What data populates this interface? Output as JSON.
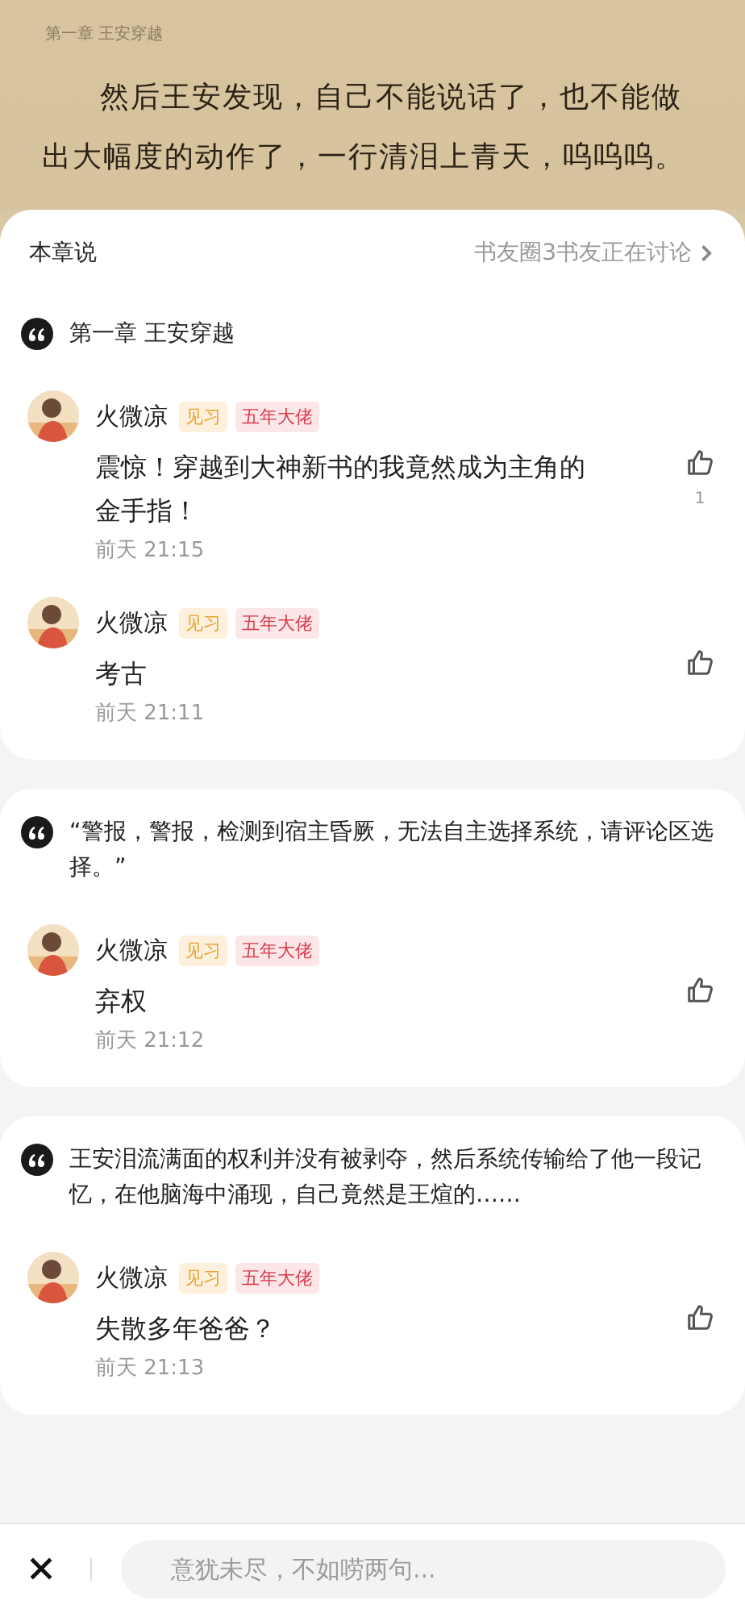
{
  "reader": {
    "chapter_title": "第一章 王安穿越",
    "paragraph": "然后王安发现，自己不能说话了，也不能做出大幅度的动作了，一行清泪上青天，呜呜呜。"
  },
  "panel": {
    "title": "本章说",
    "discussion_link": "书友圈3书友正在讨论"
  },
  "threads": [
    {
      "quote": "第一章 王安穿越",
      "comments": [
        {
          "user": "火微凉",
          "badges": [
            {
              "text": "见习",
              "kind": "level"
            },
            {
              "text": "五年大佬",
              "kind": "title"
            }
          ],
          "text": "震惊！穿越到大神新书的我竟然成为主角的金手指！",
          "time": "前天 21:15",
          "likes": "1"
        },
        {
          "user": "火微凉",
          "badges": [
            {
              "text": "见习",
              "kind": "level"
            },
            {
              "text": "五年大佬",
              "kind": "title"
            }
          ],
          "text": "考古",
          "time": "前天 21:11"
        }
      ]
    },
    {
      "quote": "“警报，警报，检测到宿主昏厥，无法自主选择系统，请评论区选择。”",
      "comments": [
        {
          "user": "火微凉",
          "badges": [
            {
              "text": "见习",
              "kind": "level"
            },
            {
              "text": "五年大佬",
              "kind": "title"
            }
          ],
          "text": "弃权",
          "time": "前天 21:12"
        }
      ]
    },
    {
      "quote": "王安泪流满面的权利并没有被剥夺，然后系统传输给了他一段记忆，在他脑海中涌现，自己竟然是王煊的……",
      "comments": [
        {
          "user": "火微凉",
          "badges": [
            {
              "text": "见习",
              "kind": "level"
            },
            {
              "text": "五年大佬",
              "kind": "title"
            }
          ],
          "text": "失散多年爸爸？",
          "time": "前天 21:13"
        }
      ]
    }
  ],
  "input": {
    "placeholder": "意犹未尽，不如唠两句..."
  }
}
